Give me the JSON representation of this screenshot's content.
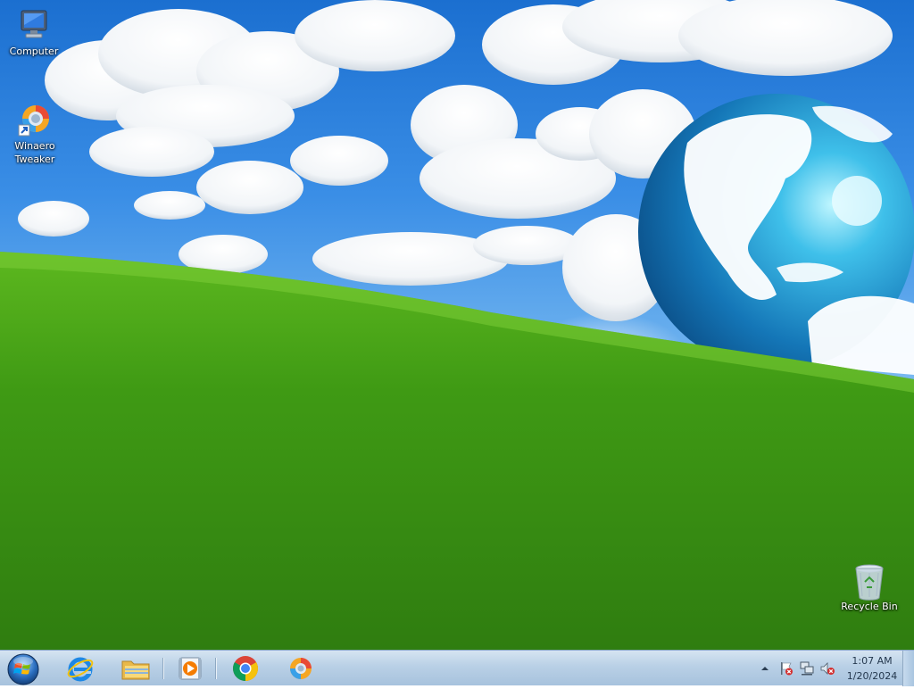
{
  "desktop": {
    "icons": [
      {
        "label": "Computer",
        "icon": "computer-icon"
      },
      {
        "label": "Winaero Tweaker",
        "icon": "winaero-tweaker-icon"
      },
      {
        "label": "Recycle Bin",
        "icon": "recycle-bin-icon"
      }
    ]
  },
  "taskbar": {
    "pinned": [
      {
        "icon": "start-orb-icon"
      },
      {
        "icon": "internet-explorer-icon"
      },
      {
        "icon": "file-explorer-icon"
      },
      {
        "icon": "media-player-icon"
      },
      {
        "icon": "chrome-icon"
      },
      {
        "icon": "winaero-tweaker-icon"
      }
    ],
    "tray": {
      "icons": [
        "show-hidden-icons-arrow",
        "action-center-flag-icon",
        "network-icon",
        "volume-muted-icon"
      ],
      "time": "1:07 AM",
      "date": "1/20/2024"
    }
  },
  "colors": {
    "sky": "#2f86e0",
    "grass": "#4aa51c",
    "taskbar": "#b9d0e6"
  }
}
